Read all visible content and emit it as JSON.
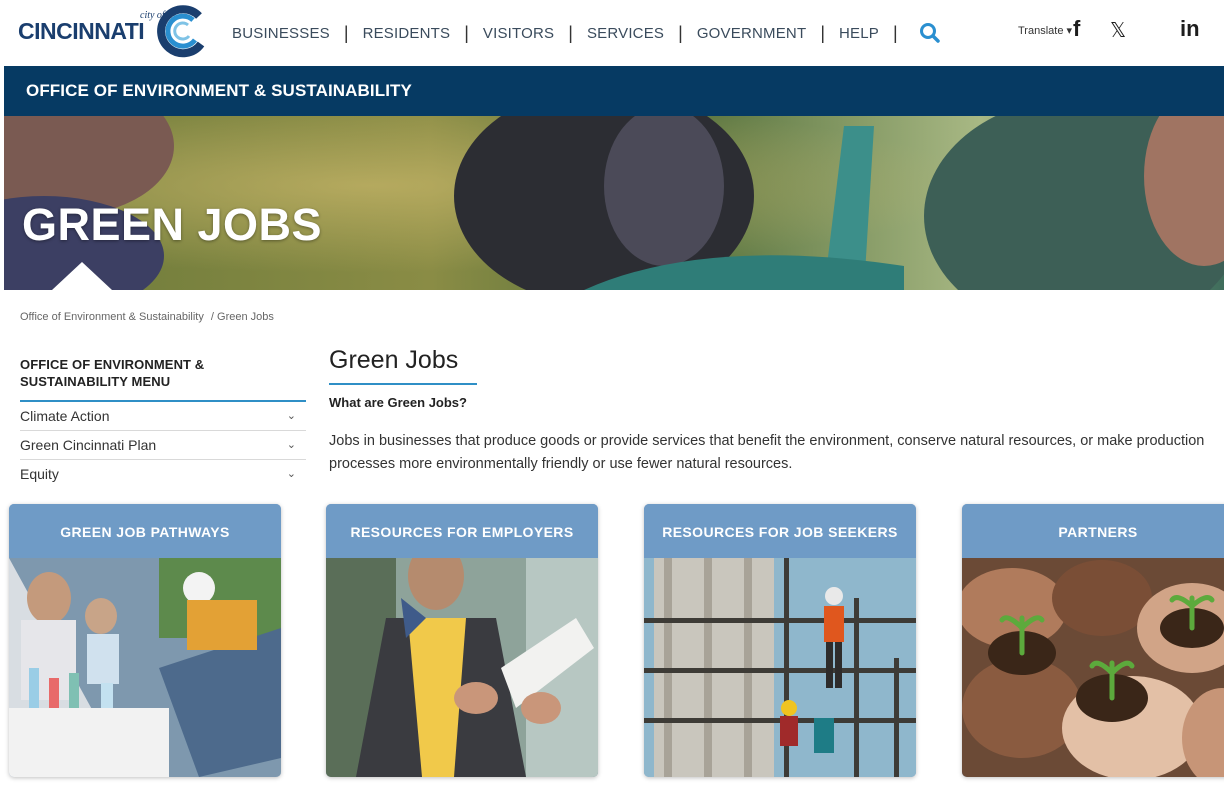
{
  "header": {
    "logo": {
      "city_of": "city of",
      "wordmark": "CINCINNATI"
    },
    "nav": [
      "BUSINESSES",
      "RESIDENTS",
      "VISITORS",
      "SERVICES",
      "GOVERNMENT",
      "HELP"
    ],
    "nav_separator": "|",
    "search_icon": "search-icon",
    "translate": "Translate ▾",
    "social": {
      "facebook": "f",
      "x": "𝕏",
      "linkedin": "in"
    }
  },
  "dept_banner": {
    "title": "OFFICE OF ENVIRONMENT & SUSTAINABILITY"
  },
  "hero": {
    "title": "GREEN JOBS"
  },
  "breadcrumb": {
    "items": [
      "Office of Environment & Sustainability",
      "/ Green Jobs"
    ]
  },
  "side_menu": {
    "heading_line1": "OFFICE OF ENVIRONMENT &",
    "heading_line2": "SUSTAINABILITY MENU",
    "chevron": "⌄",
    "items": [
      "Climate Action",
      "Green Cincinnati Plan",
      "Equity"
    ]
  },
  "main": {
    "title": "Green Jobs",
    "subheading": "What are Green Jobs?",
    "paragraph": "Jobs in businesses that produce goods or provide services that benefit the environment, conserve natural resources, or make production processes more environmentally friendly or use fewer natural resources."
  },
  "cards": [
    {
      "label": "GREEN JOB PATHWAYS"
    },
    {
      "label": "RESOURCES FOR EMPLOYERS"
    },
    {
      "label": "RESOURCES FOR JOB SEEKERS"
    },
    {
      "label": "PARTNERS"
    }
  ],
  "colors": {
    "brand_navy": "#063a63",
    "accent_blue": "#2f8fc6",
    "card_header": "#6f9bc6",
    "search_icon": "#2a8fd0"
  }
}
